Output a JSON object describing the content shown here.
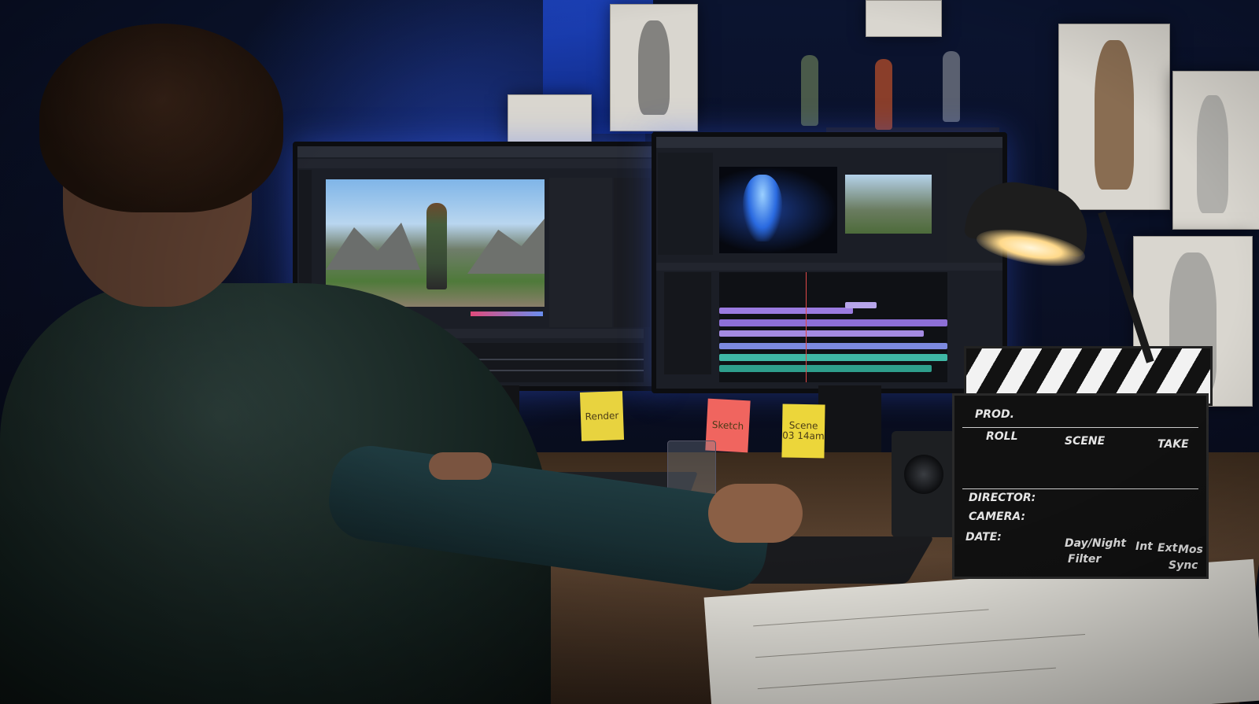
{
  "sticky_notes": [
    {
      "id": "render",
      "text": "Render",
      "color": "#e8d33f"
    },
    {
      "id": "sketch",
      "text": "Sketch",
      "color": "#f0655f"
    },
    {
      "id": "scene",
      "text": "Scene 03 14am",
      "color": "#ecd63a"
    }
  ],
  "clapperboard": {
    "prod": "PROD.",
    "roll": "ROLL",
    "scene": "SCENE",
    "take": "TAKE",
    "director": "DIRECTOR:",
    "camera": "CAMERA:",
    "date": "DATE:",
    "day_night": "Day/Night",
    "int": "Int",
    "ext": "Ext",
    "mos": "Mos",
    "filter": "Filter",
    "sync": "Sync"
  },
  "colors": {
    "accent_blue": "#2f5bff",
    "track_purple": "#9b7be0",
    "track_teal": "#3fb8a6",
    "lamp_light": "#ffd98a"
  }
}
